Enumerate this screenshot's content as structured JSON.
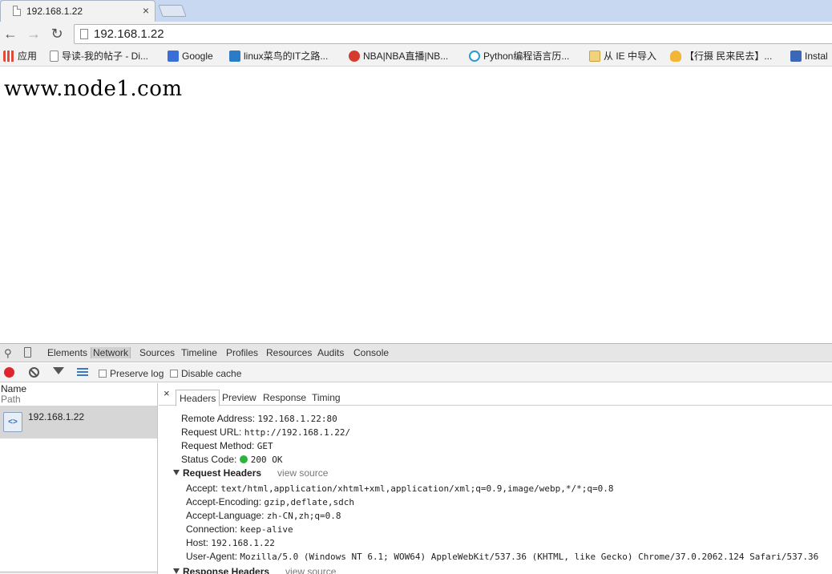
{
  "tab": {
    "title": "192.168.1.22",
    "close": "×"
  },
  "toolbar": {
    "back": "←",
    "forward": "→",
    "reload": "↻",
    "url": "192.168.1.22"
  },
  "bookmarks": [
    {
      "label": "应用",
      "icon": "apps-grid-icon",
      "color": "#e04b3b"
    },
    {
      "label": "导读-我的帖子 - Di...",
      "icon": "page-icon",
      "color": "#cfcfcf"
    },
    {
      "label": "Google",
      "icon": "google-icon",
      "color": "#3b6fd8"
    },
    {
      "label": "linux菜鸟的IT之路...",
      "icon": "blog-icon",
      "color": "#2a7cc7"
    },
    {
      "label": "NBA|NBA直播|NB...",
      "icon": "weibo-icon",
      "color": "#d63b2f"
    },
    {
      "label": "Python编程语言历...",
      "icon": "play-icon",
      "color": "#2d9ad1"
    },
    {
      "label": "从 IE 中导入",
      "icon": "folder-icon",
      "color": "#e8c45a"
    },
    {
      "label": "【行摄 民来民去】...",
      "icon": "hand-icon",
      "color": "#f1b537"
    },
    {
      "label": "Instal",
      "icon": "home-icon",
      "color": "#3a67b8"
    }
  ],
  "page": {
    "text": "www.node1.com"
  },
  "devtools": {
    "tabs": [
      "Elements",
      "Network",
      "Sources",
      "Timeline",
      "Profiles",
      "Resources",
      "Audits",
      "Console"
    ],
    "active_tab": "Network",
    "toolbar": {
      "preserve_log": "Preserve log",
      "disable_cache": "Disable cache"
    },
    "list": {
      "col_name": "Name",
      "col_path": "Path",
      "request": "192.168.1.22",
      "file_icon": "<>"
    },
    "detail": {
      "close": "×",
      "tabs": [
        "Headers",
        "Preview",
        "Response",
        "Timing"
      ],
      "general": [
        {
          "key": "Remote Address:",
          "value": "192.168.1.22:80"
        },
        {
          "key": "Request URL:",
          "value": "http://192.168.1.22/"
        },
        {
          "key": "Request Method:",
          "value": "GET"
        },
        {
          "key": "Status Code:",
          "value": "200 OK"
        }
      ],
      "request_headers_title": "Request Headers",
      "view_source": "view source",
      "request_headers": [
        {
          "key": "Accept:",
          "value": "text/html,application/xhtml+xml,application/xml;q=0.9,image/webp,*/*;q=0.8"
        },
        {
          "key": "Accept-Encoding:",
          "value": "gzip,deflate,sdch"
        },
        {
          "key": "Accept-Language:",
          "value": "zh-CN,zh;q=0.8"
        },
        {
          "key": "Connection:",
          "value": "keep-alive"
        },
        {
          "key": "Host:",
          "value": "192.168.1.22"
        },
        {
          "key": "User-Agent:",
          "value": "Mozilla/5.0 (Windows NT 6.1; WOW64) AppleWebKit/537.36 (KHTML, like Gecko) Chrome/37.0.2062.124 Safari/537.36"
        }
      ],
      "response_headers_title": "Response Headers",
      "status_color": "#2bb33a"
    }
  }
}
